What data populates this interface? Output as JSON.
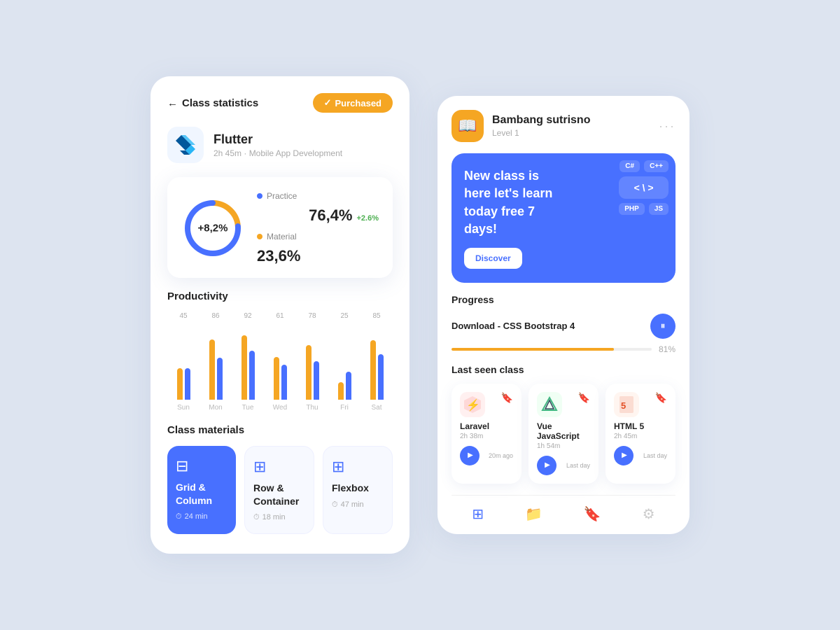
{
  "left": {
    "header": {
      "back_label": "Class statistics",
      "purchased_label": "Purchased",
      "purchased_check": "✓"
    },
    "course": {
      "title": "Flutter",
      "subtitle": "2h 45m · Mobile App Development"
    },
    "stats": {
      "donut_label": "+8,2%",
      "practice_label": "Practice",
      "practice_value": "76,4%",
      "practice_change": "+2.6%",
      "material_label": "Material",
      "material_value": "23,6%",
      "practice_color": "#4870ff",
      "material_color": "#f5a623"
    },
    "productivity": {
      "title": "Productivity",
      "bars": [
        {
          "day": "Sun",
          "blue": 45,
          "orange": 45
        },
        {
          "day": "Mon",
          "blue": 86,
          "orange": 86
        },
        {
          "day": "Tue",
          "blue": 92,
          "orange": 92
        },
        {
          "day": "Wed",
          "blue": 61,
          "orange": 61
        },
        {
          "day": "Thu",
          "blue": 78,
          "orange": 78
        },
        {
          "day": "Fri",
          "blue": 25,
          "orange": 25
        },
        {
          "day": "Sat",
          "blue": 85,
          "orange": 85
        }
      ]
    },
    "materials": {
      "title": "Class materials",
      "items": [
        {
          "name": "Grid &\nColumn",
          "time": "24 min",
          "active": true,
          "icon": "⊟"
        },
        {
          "name": "Row &\nContainer",
          "time": "18 min",
          "active": false,
          "icon": "⊞"
        },
        {
          "name": "Flexbox",
          "time": "47 min",
          "active": false,
          "icon": "⊞"
        }
      ]
    }
  },
  "right": {
    "user": {
      "name": "Bambang sutrisno",
      "level": "Level 1",
      "avatar_icon": "📖"
    },
    "banner": {
      "text": "New class is here let's learn today free 7 days!",
      "button_label": "Discover",
      "tag1": "C#",
      "tag2": "C++",
      "code_chip": "< \\ >",
      "tag3": "PHP",
      "tag4": "JS"
    },
    "progress": {
      "title": "Progress",
      "course_name": "Download - CSS Bootstrap 4",
      "percent": 81,
      "percent_label": "81%"
    },
    "last_seen": {
      "title": "Last seen class",
      "classes": [
        {
          "name": "Laravel",
          "duration": "2h 38m",
          "time_ago": "20m ago",
          "icon": "🔴",
          "bg": "#fff0f0"
        },
        {
          "name": "Vue JavaScript",
          "duration": "1h 54m",
          "time_ago": "Last day",
          "icon": "🟢",
          "bg": "#f0fff4"
        },
        {
          "name": "HTML 5",
          "duration": "2h 45m",
          "time_ago": "Last day",
          "icon": "🟠",
          "bg": "#fff5f0"
        }
      ]
    },
    "nav": {
      "items": [
        "apps",
        "folder",
        "bookmark",
        "settings"
      ]
    }
  }
}
